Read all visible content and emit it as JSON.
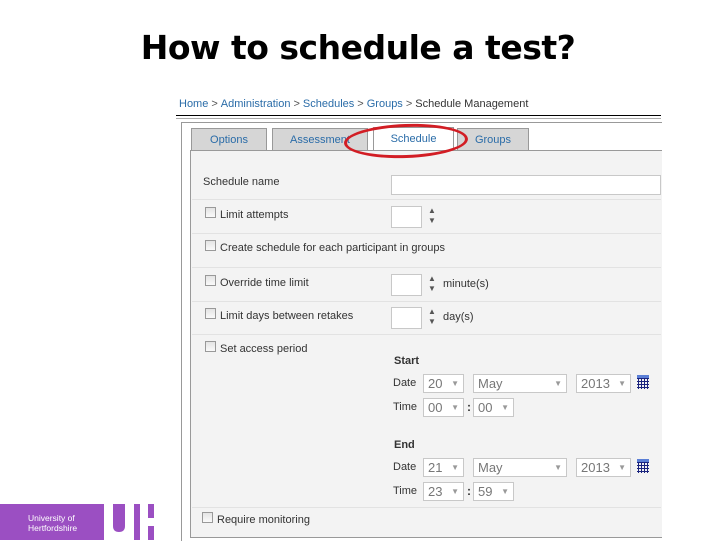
{
  "slide": {
    "title": "How to schedule a test?"
  },
  "breadcrumb": {
    "items": [
      "Home",
      "Administration",
      "Schedules",
      "Groups",
      "Schedule Management"
    ],
    "separator": ">"
  },
  "tabs": [
    {
      "label": "Options",
      "active": false
    },
    {
      "label": "Assessment",
      "active": false
    },
    {
      "label": "Schedule",
      "active": true
    },
    {
      "label": "Groups",
      "active": false
    }
  ],
  "form": {
    "schedule_name": {
      "label": "Schedule name",
      "value": ""
    },
    "limit_attempts": {
      "label": "Limit attempts",
      "checked": false,
      "value": ""
    },
    "create_for_each": {
      "label": "Create schedule for each participant in groups",
      "checked": false
    },
    "override_time": {
      "label": "Override time limit",
      "checked": false,
      "value": "",
      "unit": "minute(s)"
    },
    "limit_days": {
      "label": "Limit days between retakes",
      "checked": false,
      "value": "",
      "unit": "day(s)"
    },
    "access_period": {
      "label": "Set access period",
      "checked": false,
      "start": {
        "heading": "Start",
        "date_label": "Date",
        "time_label": "Time",
        "day": "20",
        "month": "May",
        "year": "2013",
        "hour": "00",
        "minute": "00"
      },
      "end": {
        "heading": "End",
        "date_label": "Date",
        "time_label": "Time",
        "day": "21",
        "month": "May",
        "year": "2013",
        "hour": "23",
        "minute": "59"
      },
      "time_separator": ":"
    },
    "require_monitoring": {
      "label": "Require monitoring",
      "checked": false
    }
  },
  "logo": {
    "line1": "University of",
    "line2": "Hertfordshire",
    "mark": "UH",
    "color": "#9b4fc2"
  },
  "highlight": {
    "color": "#d21d24",
    "target": "Schedule tab"
  },
  "icons": {
    "spin_up": "▲",
    "spin_down": "▼",
    "caret": "▼"
  }
}
